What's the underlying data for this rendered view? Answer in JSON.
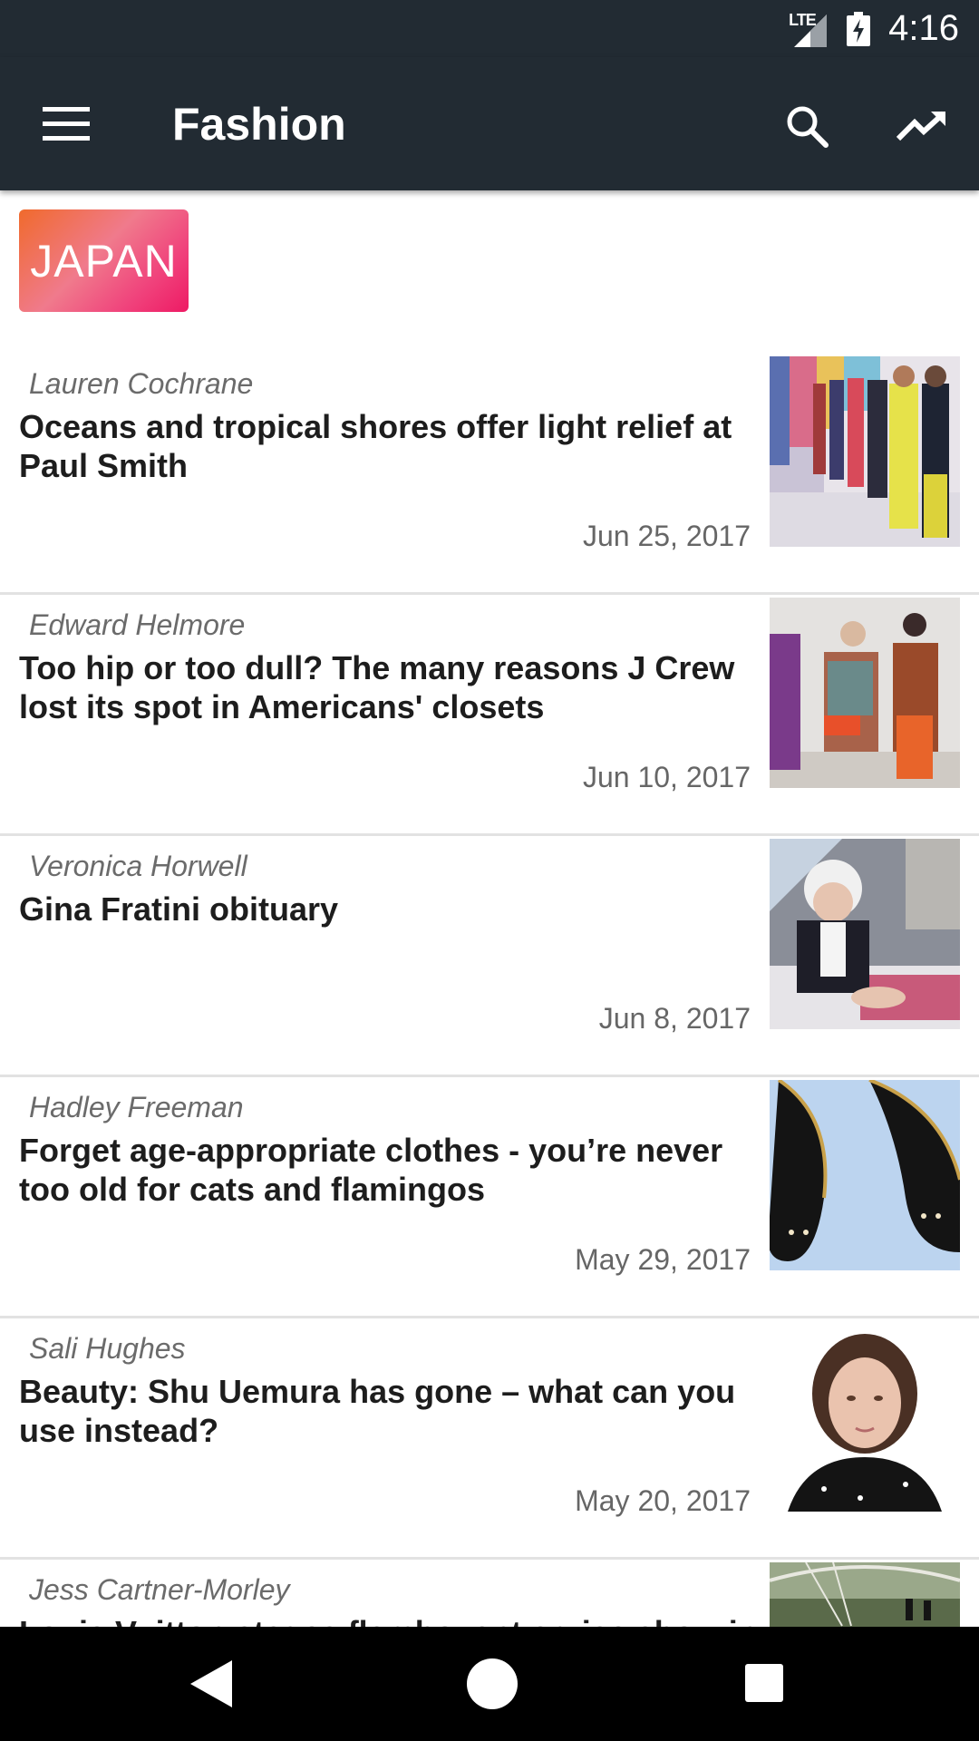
{
  "status": {
    "network": "LTE",
    "time": "4:16"
  },
  "appbar": {
    "title": "Fashion",
    "menu_icon": "hamburger-menu-icon",
    "search_icon": "search-icon",
    "trending_icon": "trending-up-icon"
  },
  "tag": {
    "label": "JAPAN"
  },
  "articles": [
    {
      "author": "Lauren Cochrane",
      "headline": "Oceans and tropical shores offer light relief at Paul Smith",
      "date": "Jun 25, 2017"
    },
    {
      "author": "Edward Helmore",
      "headline": "Too hip or too dull? The many reasons J Crew lost its spot in Americans' closets",
      "date": "Jun 10, 2017"
    },
    {
      "author": "Veronica Horwell",
      "headline": "Gina Fratini obituary",
      "date": "Jun 8, 2017"
    },
    {
      "author": "Hadley Freeman",
      "headline": "Forget age-appropriate clothes - you’re never too old for cats and flamingos",
      "date": "May 29, 2017"
    },
    {
      "author": "Sali Hughes",
      "headline": "Beauty: Shu Uemura has gone – what can you use instead?",
      "date": "May 20, 2017"
    },
    {
      "author": "Jess Cartner-Morley",
      "headline": "Louis Vuitton stages flamboyant cruise show in",
      "date": ""
    }
  ],
  "colors": {
    "appbar": "#222b33",
    "tag_start": "#f06a2c",
    "tag_end": "#ee1a64"
  }
}
